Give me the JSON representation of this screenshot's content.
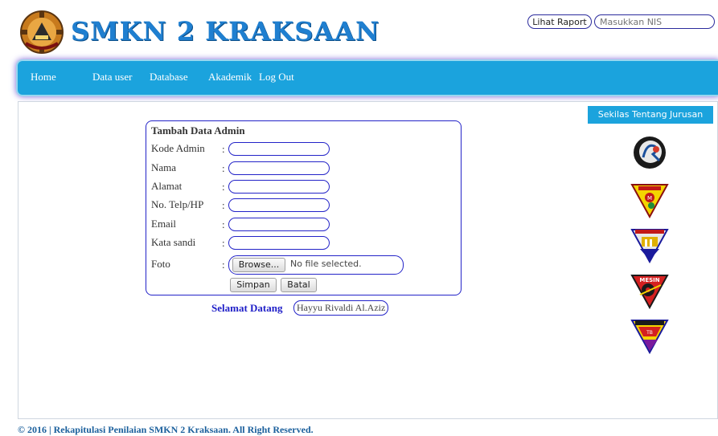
{
  "header": {
    "brand": "SMKN 2 KRAKSAAN",
    "lihat_raport_label": "Lihat Raport",
    "nis_placeholder": "Masukkan NIS"
  },
  "nav": {
    "items": [
      "Home",
      "Data user",
      "Database",
      "Akademik",
      "Log Out"
    ]
  },
  "form": {
    "title": "Tambah Data Admin",
    "fields": [
      {
        "label": "Kode Admin",
        "value": ""
      },
      {
        "label": "Nama",
        "value": ""
      },
      {
        "label": "Alamat",
        "value": ""
      },
      {
        "label": "No. Telp/HP",
        "value": ""
      },
      {
        "label": "Email",
        "value": ""
      },
      {
        "label": "Kata sandi",
        "value": ""
      }
    ],
    "photo_label": "Foto",
    "browse_label": "Browse...",
    "no_file_text": "No file selected.",
    "save_label": "Simpan",
    "cancel_label": "Batal",
    "colon": ":"
  },
  "welcome": {
    "text": "Selamat Datang",
    "username": "Hayyu Rivaldi Al.Aziz"
  },
  "sidebar": {
    "title": "Sekilas Tentang Jurusan",
    "icons": [
      "rpl-logo-icon",
      "multimedia-logo-icon",
      "bangunan-logo-icon",
      "mesin-logo-icon",
      "tata-busana-logo-icon"
    ]
  },
  "footer": {
    "text": "© 2016 | Rekapitulasi Penilaian SMKN 2 Kraksaan. All Right Reserved."
  },
  "colors": {
    "nav_bg": "#1ba3dd",
    "brand": "#1f7fd0",
    "input_border": "#2323c8",
    "welcome_text": "#2020c8",
    "footer_text": "#1a5f9c"
  }
}
